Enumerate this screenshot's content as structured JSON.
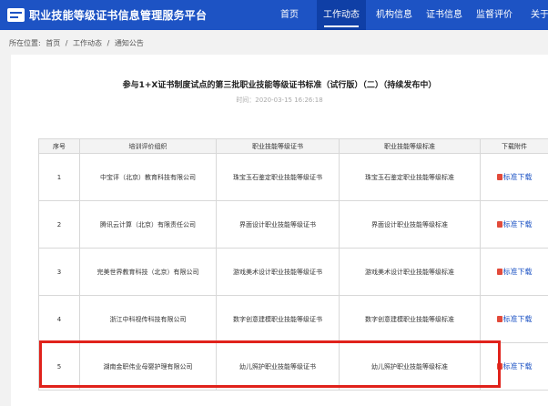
{
  "header": {
    "brand": "职业技能等级证书信息管理服务平台",
    "nav": [
      "首页",
      "工作动态",
      "机构信息",
      "证书信息",
      "监督评价",
      "关于"
    ]
  },
  "breadcrumb": [
    "所在位置:",
    "首页",
    "/",
    "工作动态",
    "/",
    "通知公告"
  ],
  "article": {
    "title": "参与1+X证书制度试点的第三批职业技能等级证书标准（试行版）（二）（持续发布中）",
    "time": "时间：2020-03-15 16:26:18"
  },
  "table": {
    "headers": [
      "序号",
      "培训评价组织",
      "职业技能等级证书",
      "职业技能等级标准",
      "下载附件"
    ],
    "rows": [
      {
        "no": "1",
        "org": "中宝评（北京）教育科技有限公司",
        "cert": "珠宝玉石鉴定职业技能等级证书",
        "std": "珠宝玉石鉴定职业技能等级标准",
        "dl": "标准下载"
      },
      {
        "no": "2",
        "org": "腾讯云计算（北京）有限责任公司",
        "cert": "界面设计职业技能等级证书",
        "std": "界面设计职业技能等级标准",
        "dl": "标准下载"
      },
      {
        "no": "3",
        "org": "完美世界教育科技（北京）有限公司",
        "cert": "游戏美术设计职业技能等级证书",
        "std": "游戏美术设计职业技能等级标准",
        "dl": "标准下载"
      },
      {
        "no": "4",
        "org": "浙江中科视传科技有限公司",
        "cert": "数字创意建模职业技能等级证书",
        "std": "数字创意建模职业技能等级标准",
        "dl": "标准下载"
      },
      {
        "no": "5",
        "org": "湖南金职伟业母婴护理有限公司",
        "cert": "幼儿照护职业技能等级证书",
        "std": "幼儿照护职业技能等级标准",
        "dl": "标准下载"
      }
    ]
  },
  "colors": {
    "header": "#1d53c4",
    "active_tab": "#0f3fa6",
    "highlight": "#e0221b",
    "link": "#1d53c4"
  }
}
